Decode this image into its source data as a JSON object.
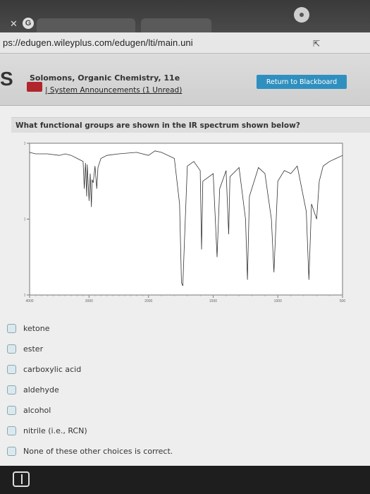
{
  "browser": {
    "url": "ps://edugen.wileyplus.com/edugen/lti/main.uni",
    "tabs": [
      "",
      ""
    ]
  },
  "header": {
    "logo_text": "S",
    "course_title": "Solomons, Organic Chemistry, 11e",
    "announcements": "| System Announcements (1 Unread)",
    "return_button": "Return to Blackboard"
  },
  "question": {
    "text": "What functional groups are shown in the IR spectrum shown below?"
  },
  "chart_data": {
    "type": "line",
    "title": "",
    "xlabel": "",
    "ylabel": "",
    "x_ticks": [
      "4000",
      "3000",
      "2000",
      "1500",
      "1000",
      "500"
    ],
    "y_ticks": [
      "100",
      "50",
      "0"
    ],
    "xlim": [
      4000,
      500
    ],
    "ylim": [
      0,
      100
    ],
    "series": [
      {
        "x": [
          4000,
          3900,
          3700,
          3500,
          3400,
          3300,
          3200,
          3100,
          3080,
          3060,
          3040,
          3030,
          3000,
          2980,
          2960,
          2950,
          2930,
          2900,
          2870,
          2850,
          2800,
          2700,
          2500,
          2200,
          2000,
          1950,
          1900,
          1800,
          1760,
          1745,
          1735,
          1720,
          1700,
          1650,
          1600,
          1590,
          1580,
          1500,
          1470,
          1450,
          1400,
          1380,
          1370,
          1300,
          1250,
          1235,
          1220,
          1150,
          1100,
          1050,
          1030,
          1000,
          950,
          900,
          850,
          780,
          760,
          740,
          700,
          680,
          650,
          600,
          550,
          500
        ],
        "y": [
          94,
          93,
          93,
          92,
          93,
          92,
          90,
          88,
          70,
          87,
          65,
          86,
          62,
          80,
          58,
          76,
          74,
          85,
          70,
          84,
          90,
          92,
          93,
          94,
          92,
          95,
          94,
          90,
          60,
          8,
          6,
          40,
          85,
          88,
          82,
          30,
          75,
          80,
          25,
          70,
          82,
          40,
          78,
          84,
          50,
          10,
          65,
          84,
          80,
          50,
          15,
          75,
          82,
          80,
          85,
          55,
          10,
          60,
          50,
          75,
          85,
          88,
          90,
          92
        ]
      }
    ]
  },
  "choices": [
    "ketone",
    "ester",
    "carboxylic acid",
    "aldehyde",
    "alcohol",
    "nitrile (i.e., RCN)",
    "None of these other choices is correct."
  ]
}
